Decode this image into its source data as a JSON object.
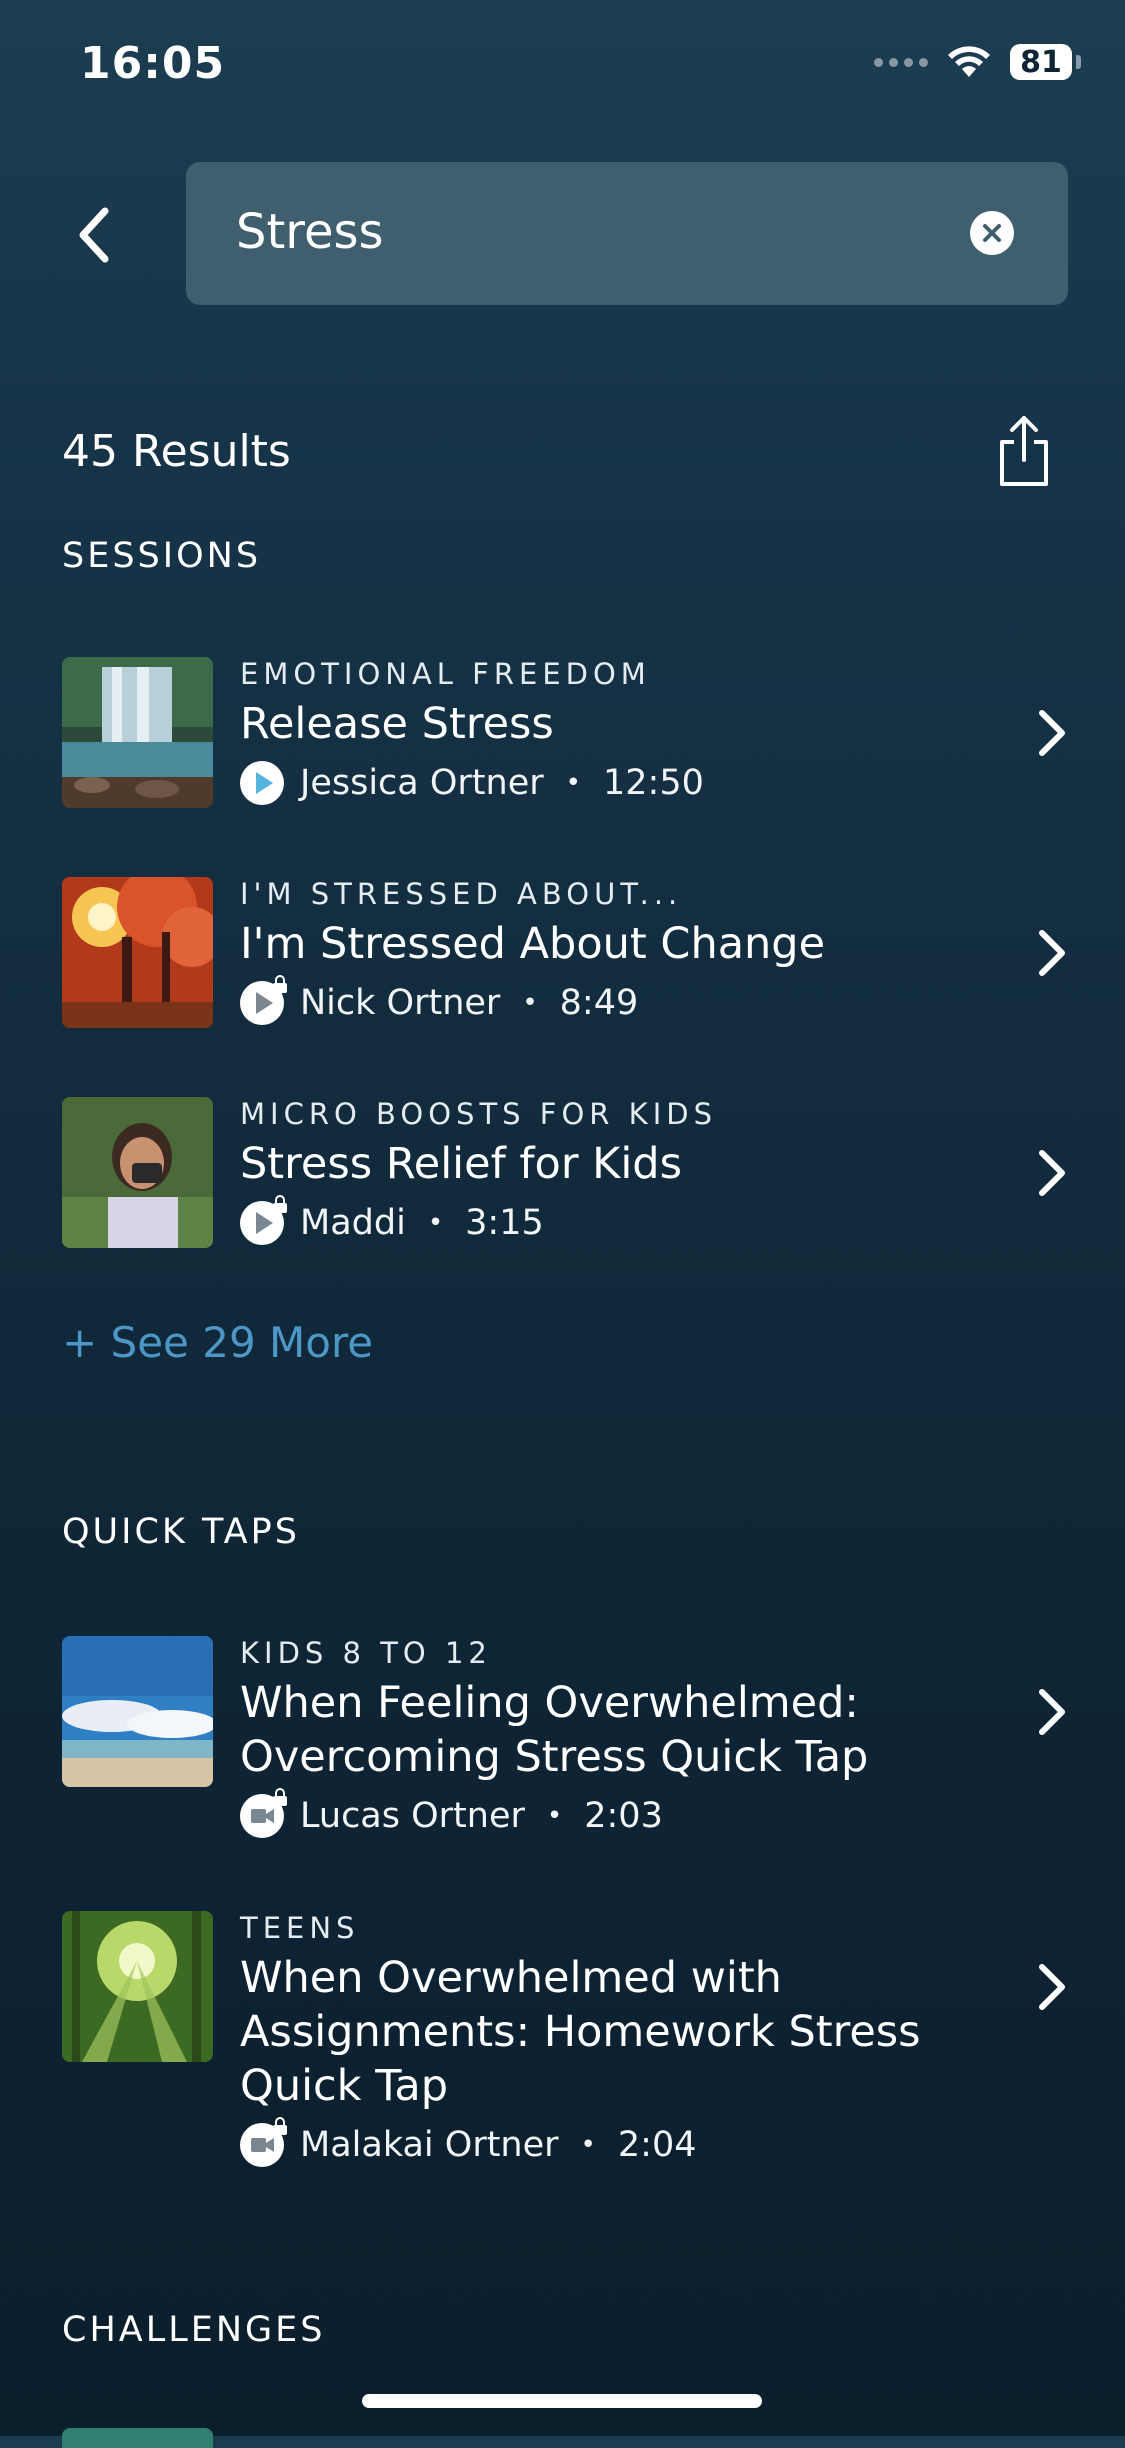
{
  "status_bar": {
    "time": "16:05",
    "battery": "81"
  },
  "search": {
    "value": "Stress"
  },
  "results": {
    "count_label": "45 Results"
  },
  "sections": {
    "sessions": {
      "title": "SESSIONS",
      "items": [
        {
          "category": "EMOTIONAL FREEDOM",
          "title": "Release Stress",
          "author": "Jessica Ortner",
          "duration": "12:50"
        },
        {
          "category": "I'M STRESSED ABOUT...",
          "title": "I'm Stressed About Change",
          "author": "Nick Ortner",
          "duration": "8:49"
        },
        {
          "category": "MICRO BOOSTS FOR KIDS",
          "title": "Stress Relief for Kids",
          "author": "Maddi",
          "duration": "3:15"
        }
      ],
      "see_more": "+ See 29 More"
    },
    "quick_taps": {
      "title": "QUICK TAPS",
      "items": [
        {
          "category": "KIDS 8 TO 12",
          "title": "When Feeling Overwhelmed: Overcoming Stress Quick Tap",
          "author": "Lucas Ortner",
          "duration": "2:03"
        },
        {
          "category": "TEENS",
          "title": "When Overwhelmed with Assignments: Homework Stress Quick Tap",
          "author": "Malakai Ortner",
          "duration": "2:04"
        }
      ]
    },
    "challenges": {
      "title": "CHALLENGES"
    }
  },
  "icons": {
    "back": "chevron-left-icon",
    "clear": "clear-icon",
    "share": "share-icon",
    "play": "play-icon",
    "video": "video-icon",
    "lock": "lock-icon",
    "row_chevron": "chevron-right-icon"
  },
  "colors": {
    "accent": "#4c97c6",
    "play_accent": "#56b3dd",
    "search_bg": "#3f5e6e"
  }
}
